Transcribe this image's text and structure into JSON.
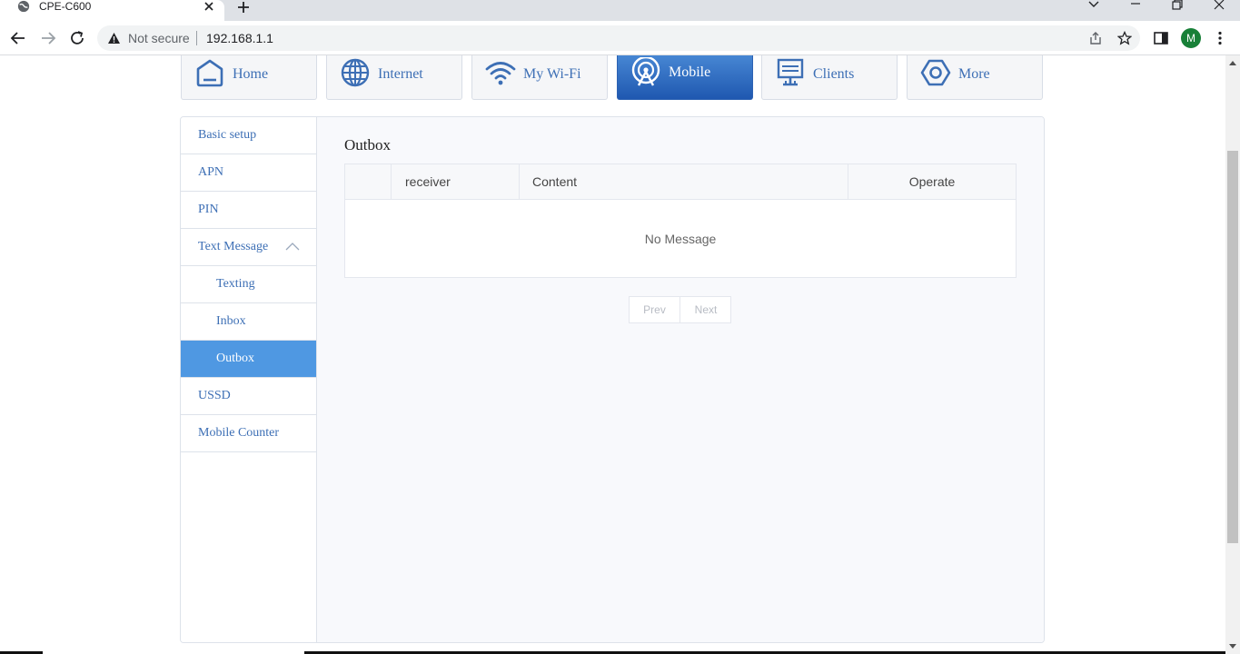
{
  "browser": {
    "tab_title": "CPE-C600",
    "security_label": "Not secure",
    "url": "192.168.1.1",
    "avatar_initial": "M"
  },
  "nav": {
    "tiles": [
      {
        "label": "Home",
        "icon": "home-icon",
        "active": false
      },
      {
        "label": "Internet",
        "icon": "globe-icon",
        "active": false
      },
      {
        "label": "My Wi-Fi",
        "icon": "wifi-icon",
        "active": false
      },
      {
        "label": "Mobile",
        "icon": "antenna-icon",
        "active": true
      },
      {
        "label": "Clients",
        "icon": "monitor-icon",
        "active": false
      },
      {
        "label": "More",
        "icon": "hexagon-nut-icon",
        "active": false
      }
    ]
  },
  "sidebar": {
    "items": [
      {
        "label": "Basic setup"
      },
      {
        "label": "APN"
      },
      {
        "label": "PIN"
      },
      {
        "label": "Text Message",
        "expanded": true
      },
      {
        "label": "Texting",
        "sub": true
      },
      {
        "label": "Inbox",
        "sub": true
      },
      {
        "label": "Outbox",
        "sub": true,
        "active": true
      },
      {
        "label": "USSD"
      },
      {
        "label": "Mobile Counter"
      }
    ]
  },
  "main": {
    "title": "Outbox",
    "table": {
      "columns": [
        "",
        "receiver",
        "Content",
        "Operate"
      ],
      "empty_text": "No Message"
    },
    "pager": {
      "prev": "Prev",
      "next": "Next"
    }
  },
  "colors": {
    "accent": "#3d6fb5",
    "active_tab": "#2d62b3",
    "active_sidebar": "#4f98e2"
  }
}
